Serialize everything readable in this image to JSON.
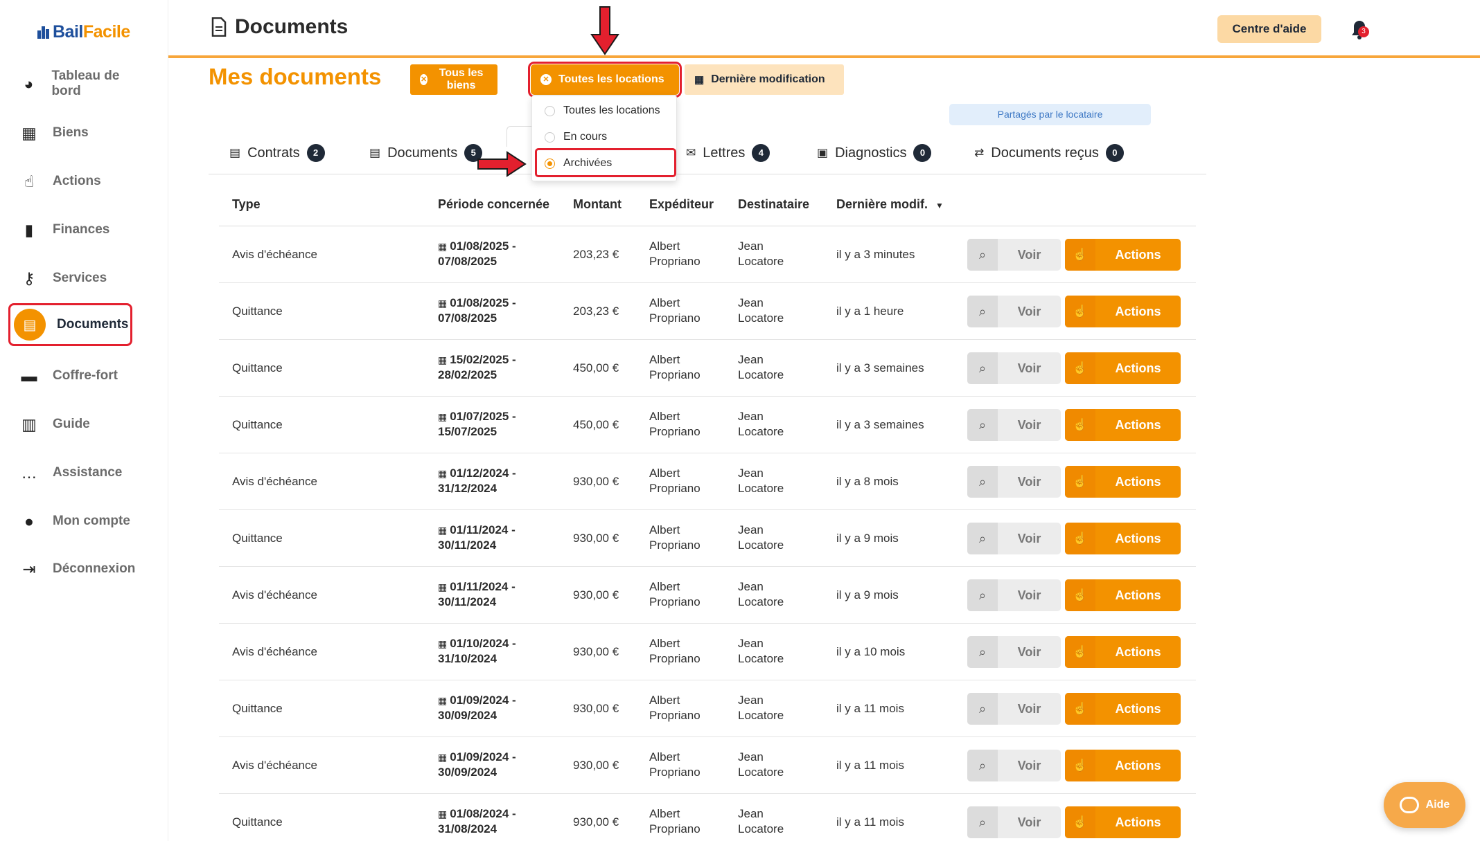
{
  "brand": {
    "name_left": "Bail",
    "name_right": "Facile"
  },
  "sidebar": {
    "items": [
      {
        "label": "Tableau de bord",
        "icon": "dashboard-icon",
        "glyph": "◕"
      },
      {
        "label": "Biens",
        "icon": "building-icon",
        "glyph": "▦"
      },
      {
        "label": "Actions",
        "icon": "pointer-hand-icon",
        "glyph": "☝"
      },
      {
        "label": "Finances",
        "icon": "bar-chart-icon",
        "glyph": "▮"
      },
      {
        "label": "Services",
        "icon": "key-icon",
        "glyph": "⚷"
      },
      {
        "label": "Documents",
        "icon": "document-icon",
        "glyph": "▤",
        "active": true
      },
      {
        "label": "Coffre-fort",
        "icon": "archive-box-icon",
        "glyph": "▬"
      },
      {
        "label": "Guide",
        "icon": "book-icon",
        "glyph": "▥"
      },
      {
        "label": "Assistance",
        "icon": "chat-icon",
        "glyph": "…"
      },
      {
        "label": "Mon compte",
        "icon": "user-icon",
        "glyph": "●"
      },
      {
        "label": "Déconnexion",
        "icon": "logout-icon",
        "glyph": "⇥"
      }
    ]
  },
  "header": {
    "title": "Documents",
    "help_center": "Centre d'aide",
    "notification_count": "3"
  },
  "content": {
    "heading": "Mes documents",
    "filters": {
      "biens": "Tous les biens",
      "locations": "Toutes les locations",
      "sort": "Dernière modification"
    },
    "dropdown": {
      "options": [
        {
          "label": "Toutes les locations",
          "selected": false
        },
        {
          "label": "En cours",
          "selected": false
        },
        {
          "label": "Archivées",
          "selected": true
        }
      ]
    },
    "shared_label": "Partagés par le locataire",
    "tabs": [
      {
        "label": "Contrats",
        "count": "2",
        "icon": "contract-icon"
      },
      {
        "label": "Documents",
        "count": "5",
        "icon": "file-icon"
      },
      {
        "label": "Lettres",
        "count": "4",
        "icon": "envelope-icon"
      },
      {
        "label": "Diagnostics",
        "count": "0",
        "icon": "clipboard-check-icon"
      },
      {
        "label": "Documents reçus",
        "count": "0",
        "icon": "exchange-icon"
      }
    ]
  },
  "table": {
    "headers": {
      "type": "Type",
      "period": "Période concernée",
      "amount": "Montant",
      "sender": "Expéditeur",
      "recipient": "Destinataire",
      "modified": "Dernière modif."
    },
    "buttons": {
      "view": "Voir",
      "actions": "Actions"
    },
    "rows": [
      {
        "type": "Avis d'échéance",
        "period_start": "01/08/2025 -",
        "period_end": "07/08/2025",
        "amount": "203,23 €",
        "sender_1": "Albert",
        "sender_2": "Propriano",
        "recipient_1": "Jean",
        "recipient_2": "Locatore",
        "modified": "il y a 3 minutes"
      },
      {
        "type": "Quittance",
        "period_start": "01/08/2025 -",
        "period_end": "07/08/2025",
        "amount": "203,23 €",
        "sender_1": "Albert",
        "sender_2": "Propriano",
        "recipient_1": "Jean",
        "recipient_2": "Locatore",
        "modified": "il y a 1 heure"
      },
      {
        "type": "Quittance",
        "period_start": "15/02/2025 -",
        "period_end": "28/02/2025",
        "amount": "450,00 €",
        "sender_1": "Albert",
        "sender_2": "Propriano",
        "recipient_1": "Jean",
        "recipient_2": "Locatore",
        "modified": "il y a 3 semaines"
      },
      {
        "type": "Quittance",
        "period_start": "01/07/2025 -",
        "period_end": "15/07/2025",
        "amount": "450,00 €",
        "sender_1": "Albert",
        "sender_2": "Propriano",
        "recipient_1": "Jean",
        "recipient_2": "Locatore",
        "modified": "il y a 3 semaines"
      },
      {
        "type": "Avis d'échéance",
        "period_start": "01/12/2024 -",
        "period_end": "31/12/2024",
        "amount": "930,00 €",
        "sender_1": "Albert",
        "sender_2": "Propriano",
        "recipient_1": "Jean",
        "recipient_2": "Locatore",
        "modified": "il y a 8 mois"
      },
      {
        "type": "Quittance",
        "period_start": "01/11/2024 -",
        "period_end": "30/11/2024",
        "amount": "930,00 €",
        "sender_1": "Albert",
        "sender_2": "Propriano",
        "recipient_1": "Jean",
        "recipient_2": "Locatore",
        "modified": "il y a 9 mois"
      },
      {
        "type": "Avis d'échéance",
        "period_start": "01/11/2024 -",
        "period_end": "30/11/2024",
        "amount": "930,00 €",
        "sender_1": "Albert",
        "sender_2": "Propriano",
        "recipient_1": "Jean",
        "recipient_2": "Locatore",
        "modified": "il y a 9 mois"
      },
      {
        "type": "Avis d'échéance",
        "period_start": "01/10/2024 -",
        "period_end": "31/10/2024",
        "amount": "930,00 €",
        "sender_1": "Albert",
        "sender_2": "Propriano",
        "recipient_1": "Jean",
        "recipient_2": "Locatore",
        "modified": "il y a 10 mois"
      },
      {
        "type": "Quittance",
        "period_start": "01/09/2024 -",
        "period_end": "30/09/2024",
        "amount": "930,00 €",
        "sender_1": "Albert",
        "sender_2": "Propriano",
        "recipient_1": "Jean",
        "recipient_2": "Locatore",
        "modified": "il y a 11 mois"
      },
      {
        "type": "Avis d'échéance",
        "period_start": "01/09/2024 -",
        "period_end": "30/09/2024",
        "amount": "930,00 €",
        "sender_1": "Albert",
        "sender_2": "Propriano",
        "recipient_1": "Jean",
        "recipient_2": "Locatore",
        "modified": "il y a 11 mois"
      },
      {
        "type": "Quittance",
        "period_start": "01/08/2024 -",
        "period_end": "31/08/2024",
        "amount": "930,00 €",
        "sender_1": "Albert",
        "sender_2": "Propriano",
        "recipient_1": "Jean",
        "recipient_2": "Locatore",
        "modified": "il y a 11 mois"
      }
    ]
  },
  "floating_help": {
    "label": "Aide"
  },
  "colors": {
    "accent": "#f39200",
    "highlight": "#e3202e",
    "dark": "#1f2937"
  }
}
